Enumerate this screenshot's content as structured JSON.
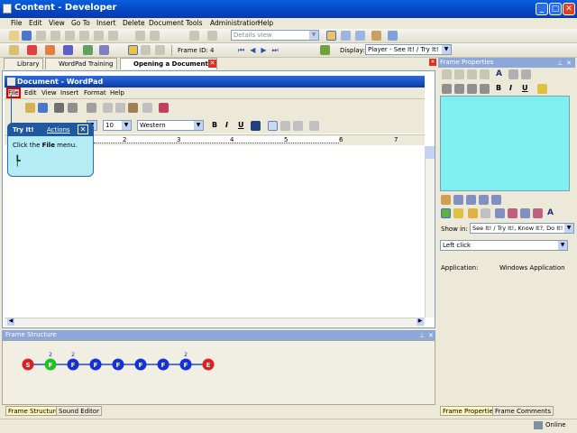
{
  "app": {
    "title": "Content - Developer"
  },
  "menu": [
    "File",
    "Edit",
    "View",
    "Go To",
    "Insert",
    "Delete",
    "Document",
    "Tools",
    "Administration",
    "Help"
  ],
  "toolbar": {
    "view_combo": "Details view",
    "frame_id_label": "Frame ID:",
    "frame_id_value": "4",
    "display_label": "Display:",
    "display_value": "Player - See It! / Try It!"
  },
  "tabs": [
    {
      "label": "Library"
    },
    {
      "label": "WordPad Training"
    },
    {
      "label": "Opening a Document"
    }
  ],
  "wordpad": {
    "title": "Document - WordPad",
    "menu": [
      "File",
      "Edit",
      "View",
      "Insert",
      "Format",
      "Help"
    ],
    "font_size": "10",
    "script": "Western",
    "ruler_numbers": [
      "1",
      "2",
      "3",
      "4",
      "5",
      "6",
      "7"
    ]
  },
  "callout": {
    "title": "Try It!",
    "actions": "Actions",
    "text_prefix": "Click the ",
    "text_bold": "File",
    "text_suffix": " menu."
  },
  "frame_properties": {
    "title": "Frame Properties",
    "show_in_label": "Show in:",
    "show_in_value": "See It! / Try It!, Know It?, Do It!",
    "action_value": "Left click",
    "application_label": "Application:",
    "application_value": "Windows Application",
    "background_color": "#7ef0f0"
  },
  "frame_structure": {
    "title": "Frame Structure",
    "nodes": [
      {
        "label": "S",
        "color": "#e02020",
        "badge": ""
      },
      {
        "label": "F",
        "color": "#22c022",
        "badge": "2"
      },
      {
        "label": "F",
        "color": "#1530d8",
        "badge": "2"
      },
      {
        "label": "F",
        "color": "#1530d8",
        "badge": ""
      },
      {
        "label": "F",
        "color": "#1530d8",
        "badge": ""
      },
      {
        "label": "F",
        "color": "#1530d8",
        "badge": ""
      },
      {
        "label": "F",
        "color": "#1530d8",
        "badge": ""
      },
      {
        "label": "F",
        "color": "#1530d8",
        "badge": "2"
      },
      {
        "label": "E",
        "color": "#e02020",
        "badge": ""
      }
    ]
  },
  "bottom_tabs_left": [
    "Frame Structure",
    "Sound Editor"
  ],
  "bottom_tabs_right": [
    "Frame Properties",
    "Frame Comments"
  ],
  "status": {
    "online": "Online"
  }
}
